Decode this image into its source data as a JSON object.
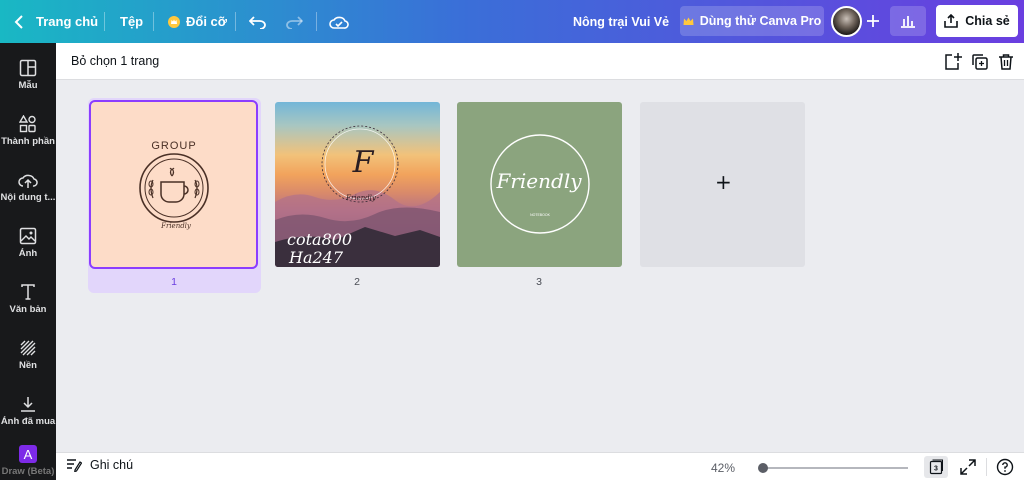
{
  "topbar": {
    "home_label": "Trang chủ",
    "file_label": "Tệp",
    "resize_label": "Đổi cỡ",
    "project_title": "Nông trại Vui Vẻ",
    "try_pro_label": "Dùng thử Canva Pro",
    "share_label": "Chia sẻ"
  },
  "sidebar": {
    "items": [
      {
        "label": "Mẫu",
        "icon": "template-icon"
      },
      {
        "label": "Thành phần",
        "icon": "elements-icon"
      },
      {
        "label": "Nội dung t...",
        "icon": "upload-icon"
      },
      {
        "label": "Ảnh",
        "icon": "photo-icon"
      },
      {
        "label": "Văn bản",
        "icon": "text-icon"
      },
      {
        "label": "Nền",
        "icon": "background-icon"
      },
      {
        "label": "Ảnh đã mua",
        "icon": "download-icon"
      },
      {
        "label": "Draw (Beta)",
        "icon": "draw-icon"
      }
    ]
  },
  "subbar": {
    "selection_label": "Bỏ chọn 1 trang"
  },
  "pages": [
    {
      "number": "1",
      "logo_top": "GROUP",
      "logo_bottom": "Friendly"
    },
    {
      "number": "2",
      "monogram": "F",
      "caption": "Friendly",
      "watermark_1": "cota800",
      "watermark_2": "Ha247"
    },
    {
      "number": "3",
      "title": "Friendly",
      "subtitle": "NOTEBOOK"
    }
  ],
  "add_page_symbol": "+",
  "bottombar": {
    "notes_label": "Ghi chú",
    "zoom": "42%",
    "page_count": "3"
  },
  "colors": {
    "accent": "#8b3dff",
    "sidebar_bg": "#18191b",
    "page1_bg": "#fddcc8",
    "page3_bg": "#8ba47e"
  }
}
